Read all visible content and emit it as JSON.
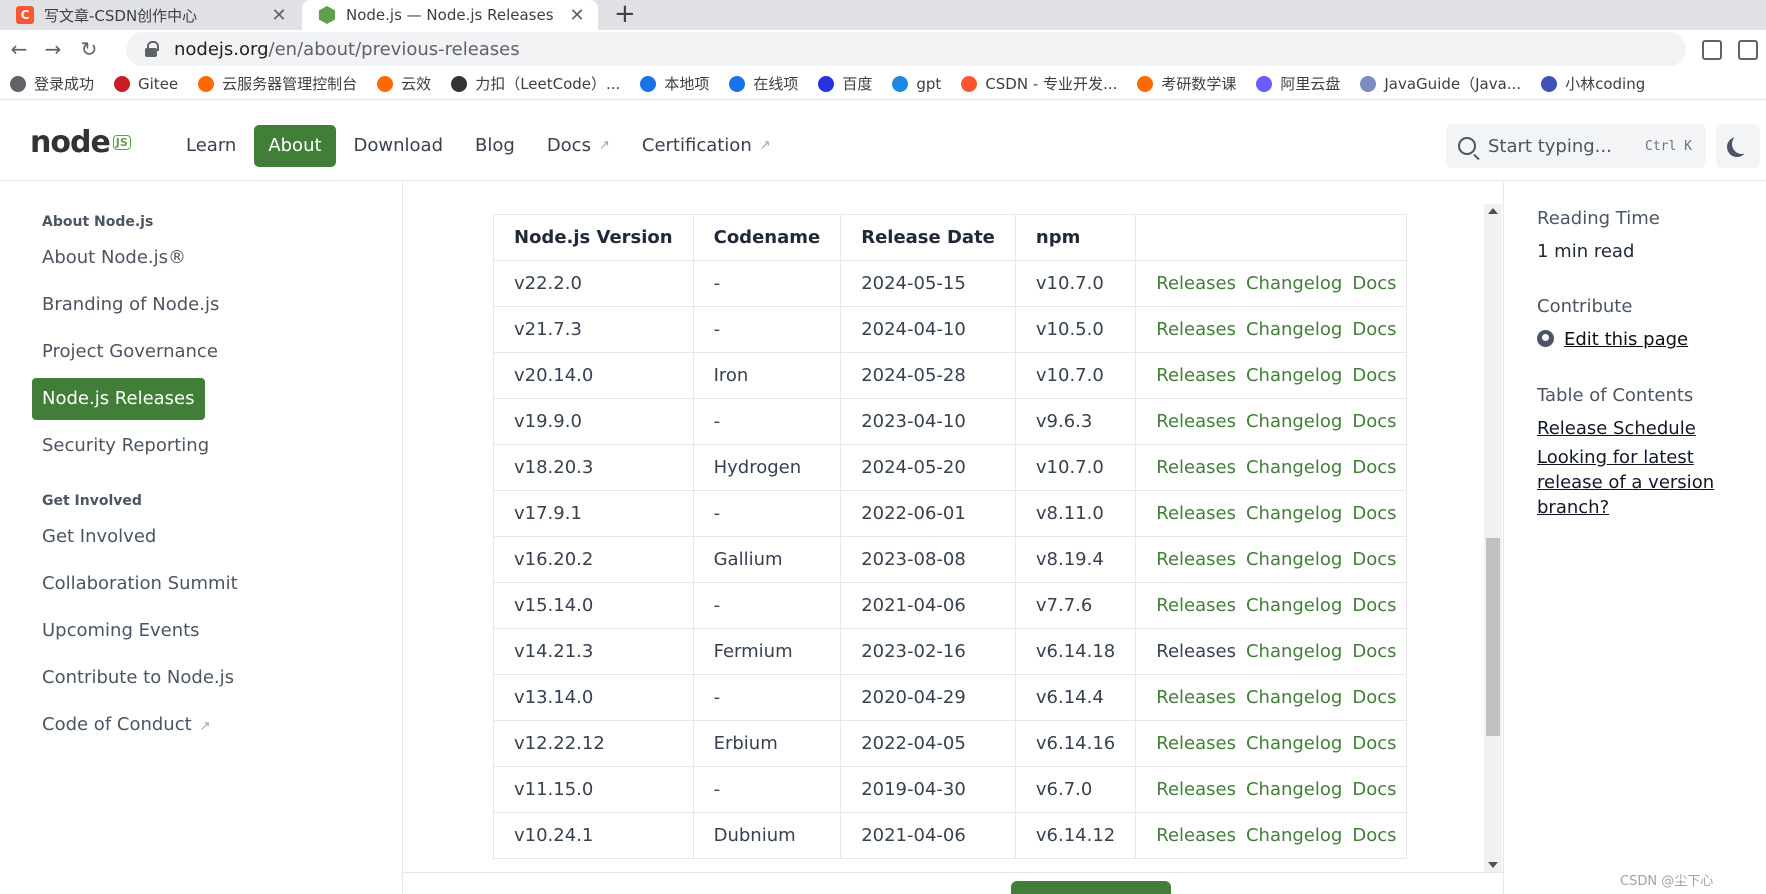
{
  "browser": {
    "tabs": [
      {
        "title": "写文章-CSDN创作中心",
        "favicon": "csdn-icon"
      },
      {
        "title": "Node.js — Node.js Releases",
        "favicon": "nodejs-icon"
      }
    ],
    "url_host": "nodejs.org",
    "url_path": "/en/about/previous-releases",
    "bookmarks": [
      {
        "label": "登录成功",
        "icon": "globe-icon",
        "color": "#5f6368"
      },
      {
        "label": "Gitee",
        "icon": "gitee-icon",
        "color": "#c71d23"
      },
      {
        "label": "云服务器管理控制台",
        "icon": "aliyun-icon",
        "color": "#ff6a00"
      },
      {
        "label": "云效",
        "icon": "aliyun-icon",
        "color": "#ff6a00"
      },
      {
        "label": "力扣（LeetCode）...",
        "icon": "leetcode-icon",
        "color": "#333333"
      },
      {
        "label": "本地项",
        "icon": "plus-icon",
        "color": "#1a73e8"
      },
      {
        "label": "在线项",
        "icon": "plus-icon",
        "color": "#1a73e8"
      },
      {
        "label": "百度",
        "icon": "baidu-icon",
        "color": "#2932e1"
      },
      {
        "label": "gpt",
        "icon": "chat-icon",
        "color": "#1e88e5"
      },
      {
        "label": "CSDN - 专业开发...",
        "icon": "csdn-icon",
        "color": "#fc5531"
      },
      {
        "label": "考研数学课",
        "icon": "play-icon",
        "color": "#ff6a00"
      },
      {
        "label": "阿里云盘",
        "icon": "cloud-drive-icon",
        "color": "#6b5bff"
      },
      {
        "label": "JavaGuide（Java...",
        "icon": "javaguide-icon",
        "color": "#7b8bbd"
      },
      {
        "label": "小林coding",
        "icon": "avatar-icon",
        "color": "#3f51b5"
      }
    ]
  },
  "site": {
    "nav": [
      {
        "label": "Learn",
        "active": false,
        "external": false
      },
      {
        "label": "About",
        "active": true,
        "external": false
      },
      {
        "label": "Download",
        "active": false,
        "external": false
      },
      {
        "label": "Blog",
        "active": false,
        "external": false
      },
      {
        "label": "Docs",
        "active": false,
        "external": true
      },
      {
        "label": "Certification",
        "active": false,
        "external": true
      }
    ],
    "search_placeholder": "Start typing...",
    "search_shortcut": "Ctrl K",
    "accent_color": "#417e38"
  },
  "sidebar": {
    "groups": [
      {
        "heading": "About Node.js",
        "items": [
          {
            "label": "About Node.js®",
            "active": false,
            "external": false
          },
          {
            "label": "Branding of Node.js",
            "active": false,
            "external": false
          },
          {
            "label": "Project Governance",
            "active": false,
            "external": false
          },
          {
            "label": "Node.js Releases",
            "active": true,
            "external": false
          },
          {
            "label": "Security Reporting",
            "active": false,
            "external": false
          }
        ]
      },
      {
        "heading": "Get Involved",
        "items": [
          {
            "label": "Get Involved",
            "active": false,
            "external": false
          },
          {
            "label": "Collaboration Summit",
            "active": false,
            "external": false
          },
          {
            "label": "Upcoming Events",
            "active": false,
            "external": false
          },
          {
            "label": "Contribute to Node.js",
            "active": false,
            "external": false
          },
          {
            "label": "Code of Conduct",
            "active": false,
            "external": true
          }
        ]
      }
    ]
  },
  "table": {
    "headers": [
      "Node.js Version",
      "Codename",
      "Release Date",
      "npm"
    ],
    "link_labels": [
      "Releases",
      "Changelog",
      "Docs"
    ],
    "rows": [
      {
        "version": "v22.2.0",
        "codename": "-",
        "date": "2024-05-15",
        "npm": "v10.7.0",
        "releases_plain": false
      },
      {
        "version": "v21.7.3",
        "codename": "-",
        "date": "2024-04-10",
        "npm": "v10.5.0",
        "releases_plain": false
      },
      {
        "version": "v20.14.0",
        "codename": "Iron",
        "date": "2024-05-28",
        "npm": "v10.7.0",
        "releases_plain": false
      },
      {
        "version": "v19.9.0",
        "codename": "-",
        "date": "2023-04-10",
        "npm": "v9.6.3",
        "releases_plain": false
      },
      {
        "version": "v18.20.3",
        "codename": "Hydrogen",
        "date": "2024-05-20",
        "npm": "v10.7.0",
        "releases_plain": false
      },
      {
        "version": "v17.9.1",
        "codename": "-",
        "date": "2022-06-01",
        "npm": "v8.11.0",
        "releases_plain": false
      },
      {
        "version": "v16.20.2",
        "codename": "Gallium",
        "date": "2023-08-08",
        "npm": "v8.19.4",
        "releases_plain": false
      },
      {
        "version": "v15.14.0",
        "codename": "-",
        "date": "2021-04-06",
        "npm": "v7.7.6",
        "releases_plain": false
      },
      {
        "version": "v14.21.3",
        "codename": "Fermium",
        "date": "2023-02-16",
        "npm": "v6.14.18",
        "releases_plain": true
      },
      {
        "version": "v13.14.0",
        "codename": "-",
        "date": "2020-04-29",
        "npm": "v6.14.4",
        "releases_plain": false
      },
      {
        "version": "v12.22.12",
        "codename": "Erbium",
        "date": "2022-04-05",
        "npm": "v6.14.16",
        "releases_plain": false
      },
      {
        "version": "v11.15.0",
        "codename": "-",
        "date": "2019-04-30",
        "npm": "v6.7.0",
        "releases_plain": false
      },
      {
        "version": "v10.24.1",
        "codename": "Dubnium",
        "date": "2021-04-06",
        "npm": "v6.14.12",
        "releases_plain": false
      }
    ]
  },
  "aside": {
    "reading_time_label": "Reading Time",
    "reading_time_value": "1 min read",
    "contribute_label": "Contribute",
    "edit_link": "Edit this page",
    "toc_label": "Table of Contents",
    "toc_items": [
      "Release Schedule",
      "Looking for latest release of a version branch?"
    ]
  },
  "watermark": "CSDN @尘下心"
}
